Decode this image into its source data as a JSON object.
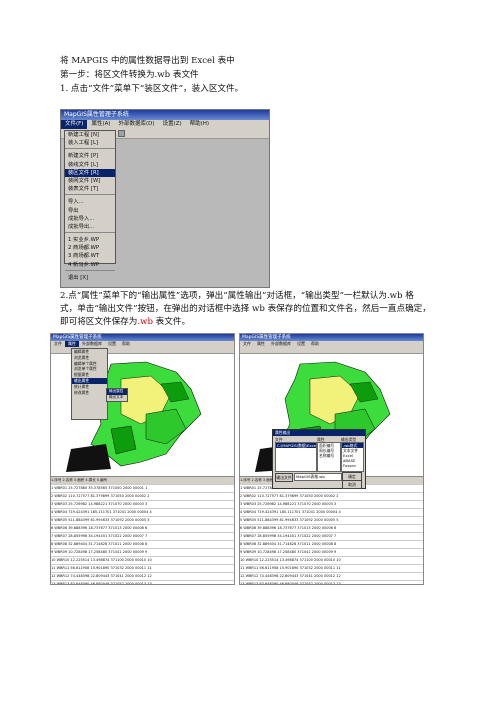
{
  "doc": {
    "title": "将 MAPGIS 中的属性数据导出到 Excel 表中",
    "step1": "第一步：将区文件转换为.wb 表文件",
    "step1_item": "1.   点击“文件”菜单下“装区文件”，装入区文件。",
    "step2_line1": "2.点“属性”菜单下的“输出属性”选项，弹出“属性输出”对话框，“输出类型”一栏默认为.wb 格",
    "step2_line2": "式，单击“输出文件”按钮，在弹出的对话框中选择 wb 表保存的位置和文件名，然后一直点确定，",
    "step2_line3_a": "即可将区文件保存为",
    "step2_line3_b": ".wb",
    "step2_line3_c": " 表文件。"
  },
  "shot1": {
    "title": "MapGIS属性管理子系统",
    "menus": [
      "文件(F)",
      "属性(A)",
      "外部数据库(D)",
      "设置(Z)",
      "帮助(H)"
    ],
    "file_menu": [
      "新建工程 [N]",
      "装入工程 [L]",
      "新建文件 [P]",
      "装线文件 [L]",
      "装区文件 [R]",
      "装网文件 [W]",
      "装表文件 [T]",
      "导入...",
      "导出",
      "成批导入...",
      "成批导出...",
      "1 实业乡.WP",
      "2 商场都.WP",
      "3 商场都.WT",
      "4 新马乡.WP",
      "退出 [X]"
    ],
    "selected_index": 4
  },
  "shot2": {
    "title": "MapGIS属性管理子系统",
    "menus": [
      "文件",
      "属性",
      "外部数据库",
      "设置",
      "帮助"
    ],
    "attr_menu": [
      "编辑属性",
      "浏览属性",
      "编辑单个属性",
      "浏览单个属性",
      "根据属性",
      "输出属性",
      "统计属性",
      "修改属性"
    ],
    "selected_index": 5,
    "submenu": [
      "输出属性",
      "输出文本"
    ],
    "tabs": "1.序号  2.名称  3.面积  4.周长  5.编号",
    "rows": [
      "1  WBR01  25.727880  35.378565  371000 2000 00001 1",
      "2  WBR02  110.727577  81.379899  371050 2000 00002 2",
      "3  WBR03  25.726982  14.988221  371070 2000 00003 3",
      "4  WBR04  719.424391  185.111701  371041 2000 00004 4",
      "5  WBR05  511.884399  81.994633  371092 2000 00005 5",
      "6  WBR06  39.888396  18.737677  371013 2000 00006 6",
      "7  WBR07  28.855998  34.194451  371022 2000 00007 7",
      "8  WBR08  32.889404  31.714828  371011 2000 00008 8",
      "9  WBR09  10.728498  17.258480  371041 2000 00009 9",
      "10  WBR10  12.225514  13.498874  371100 2000 00010 10",
      "11  WBR11  56.611958  15.901890  371032 2000 00011 11",
      "12  WBR12  74.448398  22.809443  371041 2000 00012 12",
      "13  WBR13  83.648390  46.880049  371052 2000 00013 13",
      "14  WBR14  53.962398  14.373818  371021 2000 00014 14",
      "15  WBR15  53.962398  17.903148  371032 2000 00015 15"
    ]
  },
  "shot3": {
    "title": "MapGIS属性管理子系统",
    "menus": [
      "文件",
      "属性",
      "外部数据库",
      "设置",
      "帮助"
    ],
    "dialog_title": "属性输出",
    "list1_header": "文件",
    "list2_header": "属性",
    "list3_header": "输出类型",
    "list1": [
      "C:\\MAPGIS\\数据\\Excel区.WP"
    ],
    "list2": [
      "面积编号",
      "周长编号",
      "名称编号"
    ],
    "list3": [
      ".wb格式",
      "文本文件",
      "Excel",
      "dBASE",
      "Foxpro"
    ],
    "output_label": "输出文件",
    "output_value": "MapGIS表格.wb",
    "ok": "确定",
    "cancel": "取消",
    "tabs": "1.序号  2.名称  3.面积  4.周长  5.编号",
    "rows": [
      "1  WBR01  25.727880  35.378565  371000 2000 00001 1",
      "2  WBR02  110.727577  81.379899  371050 2000 00002 2",
      "3  WBR03  25.726982  14.988221  371070 2000 00003 3",
      "4  WBR04  719.424391  185.111701  371041 2000 00004 4",
      "5  WBR05  511.884399  81.994633  371092 2000 00005 5",
      "6  WBR06  39.888396  18.737677  371013 2000 00006 6",
      "7  WBR07  28.855998  34.194451  371022 2000 00007 7",
      "8  WBR08  32.889404  31.714828  371011 2000 00008 8",
      "9  WBR09  10.728498  17.258480  371041 2000 00009 9",
      "10  WBR10  12.225514  13.498874  371100 2000 00010 10",
      "11  WBR11  56.611958  15.901890  371032 2000 00011 11",
      "12  WBR12  74.448398  22.809443  371041 2000 00012 12",
      "13  WBR13  83.648390  46.880049  371052 2000 00013 13",
      "14  WBR14  53.962398  14.373818  371021 2000 00014 14",
      "15  WBR15  53.962398  17.903148  371032 2000 00015 15"
    ]
  }
}
